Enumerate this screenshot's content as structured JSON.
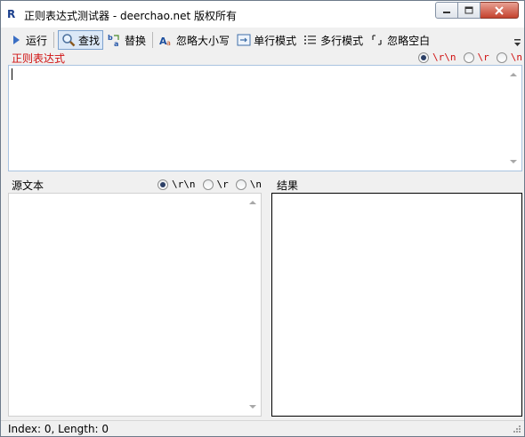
{
  "window": {
    "title": "正则表达式测试器 - deerchao.net 版权所有",
    "app_icon": "R"
  },
  "toolbar": {
    "run": "运行",
    "find": "查找",
    "replace": "替换",
    "ignore_case": "忽略大小写",
    "single_line": "单行模式",
    "multi_line": "多行模式",
    "ignore_whitespace": "忽略空白"
  },
  "regex": {
    "label": "正则表达式",
    "value": "",
    "newline_options": [
      "\\r\\n",
      "\\r",
      "\\n"
    ],
    "selected_newline": "\\r\\n"
  },
  "source": {
    "label": "源文本",
    "value": "",
    "newline_options": [
      "\\r\\n",
      "\\r",
      "\\n"
    ],
    "selected_newline": "\\r\\n"
  },
  "result": {
    "label": "结果"
  },
  "status": {
    "text": "Index: 0, Length: 0"
  },
  "colors": {
    "label_red": "#d01010",
    "active_button": "#dbe8f7",
    "close_button": "#c4422d"
  }
}
